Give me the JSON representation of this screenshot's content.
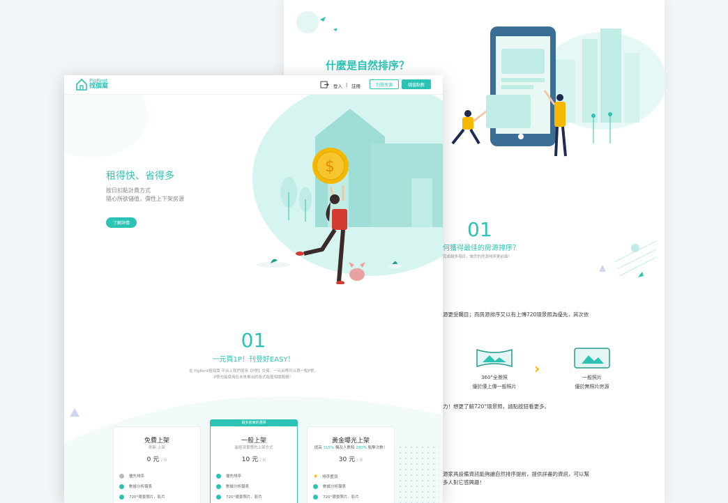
{
  "back_page": {
    "heading": "什麼是自然排序？",
    "section_number": "01",
    "section_heading": "何獲得最佳的房源排序？",
    "section_sub": "完成越多項目，讓您的房源排序更前面！",
    "paragraph": "源更受矚目；而房源排序又以有上傳720環景照為優先，其次依",
    "photo_types": [
      {
        "title": "360°全景照",
        "caption": "優於僅上傳一般照片",
        "icon": "panorama-photo-icon"
      },
      {
        "title": "一般照片",
        "caption": "優於無照片房源",
        "icon": "photo-icon"
      }
    ],
    "arrow_icon": "chevron-right-icon",
    "paragraph2": "力！想更了解720°環景照，請點按鈕看更多。",
    "paragraph3": "源家具設備資訊能夠讓自然排序提前，提供詳盡的資訊，可以幫",
    "paragraph4": "多人對它感興趣！"
  },
  "front_page": {
    "logo": {
      "brand_en": "PigRent",
      "brand_zh": "找個窩"
    },
    "nav": {
      "login": "登入",
      "separator": "|",
      "register": "註冊",
      "post_button": "刊登房源",
      "buy_button": "儲值點數"
    },
    "hero": {
      "title": "租得快、省得多",
      "line1": "按日扣點計費方式",
      "line2": "隨心所欲儲值，彈性上下架房源",
      "cta": "了解詳情"
    },
    "section": {
      "number": "01",
      "heading": "一元買1P！刊登好EASY！",
      "desc1": "在 PigRent租個窩 平台上我們使用【P幣】交易，一元台幣可以買一點P幣，",
      "desc2": "P幣也能使用在未來推出的各式租屋相關服務！"
    },
    "plans": [
      {
        "badge": "",
        "title": "免費上架",
        "subtitle": "刷新 上架",
        "price": "0 元",
        "unit": "/ 月",
        "features": [
          {
            "icon": "minus-circle-icon",
            "text": "優先排序"
          },
          {
            "icon": "check-circle-icon",
            "text": "數據分析報表"
          },
          {
            "icon": "check-circle-icon",
            "text": "720°環景照片．影片"
          }
        ]
      },
      {
        "badge": "最多房東的選擇",
        "title": "一般上架",
        "subtitle": "最經濟實惠的上架方式",
        "price": "10 元",
        "unit": "/ 月",
        "features": [
          {
            "icon": "check-circle-icon",
            "text": "優先排序"
          },
          {
            "icon": "check-circle-icon",
            "text": "數據分析報表"
          },
          {
            "icon": "check-circle-icon",
            "text": "720°環景照片．影片"
          }
        ]
      },
      {
        "badge": "",
        "title": "黃金曝光上架",
        "subtitle_parts": [
          "提高 ",
          "315%",
          " 觸及人數和 ",
          "280%",
          " 點擊次數！"
        ],
        "price": "30 元",
        "unit": "/ 月",
        "features": [
          {
            "icon": "star-icon",
            "text": "排序置頂"
          },
          {
            "icon": "check-circle-icon",
            "text": "數據分析報表"
          },
          {
            "icon": "check-circle-icon",
            "text": "720°環景照片．影片"
          }
        ]
      }
    ]
  },
  "colors": {
    "accent": "#2dc3b4",
    "accent_light": "#d6f5f1",
    "yellow": "#f5b800",
    "red": "#e0473c"
  }
}
